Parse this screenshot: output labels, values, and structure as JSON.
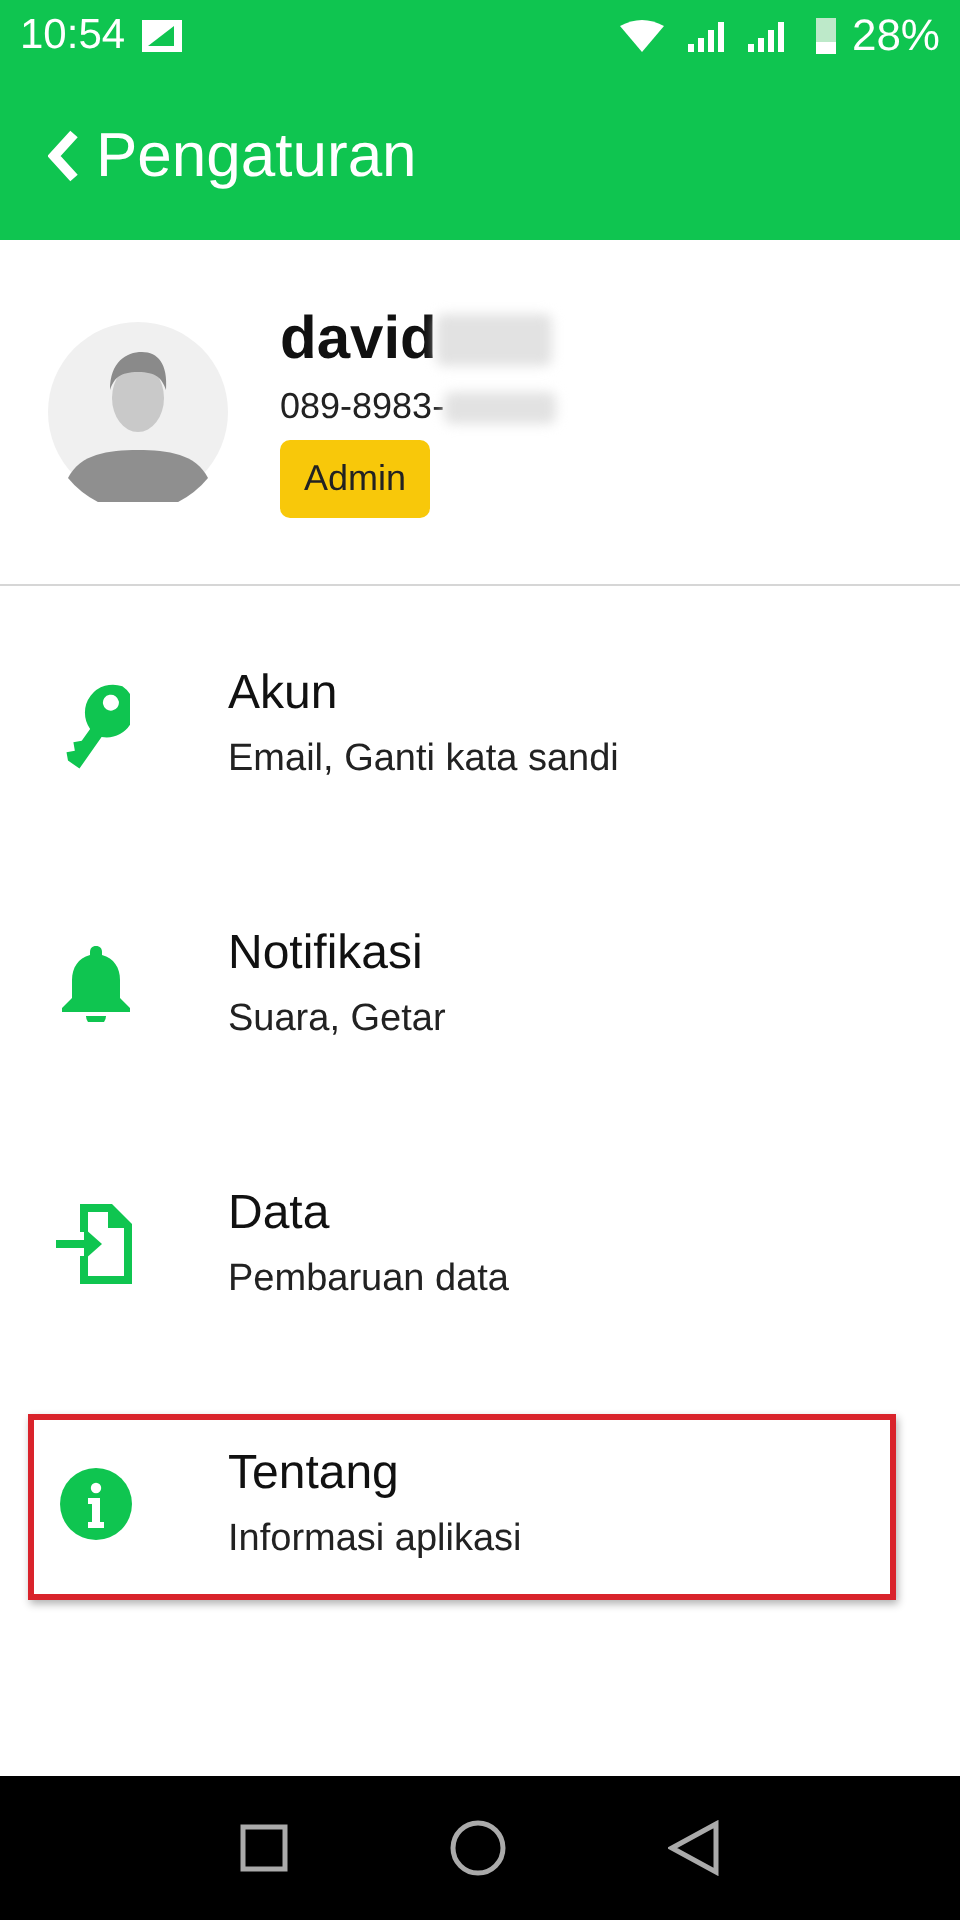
{
  "status_bar": {
    "time": "10:54",
    "battery": "28%"
  },
  "header": {
    "title": "Pengaturan"
  },
  "profile": {
    "name": "david",
    "phone": "089-8983-",
    "role": "Admin",
    "name_redacted": true,
    "phone_redacted": true
  },
  "menu": [
    {
      "kind": "key",
      "title": "Akun",
      "subtitle": "Email, Ganti kata sandi",
      "highlighted": false
    },
    {
      "kind": "bell",
      "title": "Notifikasi",
      "subtitle": "Suara, Getar",
      "highlighted": false
    },
    {
      "kind": "import",
      "title": "Data",
      "subtitle": "Pembaruan data",
      "highlighted": false
    },
    {
      "kind": "info",
      "title": "Tentang",
      "subtitle": "Informasi aplikasi",
      "highlighted": true
    }
  ]
}
